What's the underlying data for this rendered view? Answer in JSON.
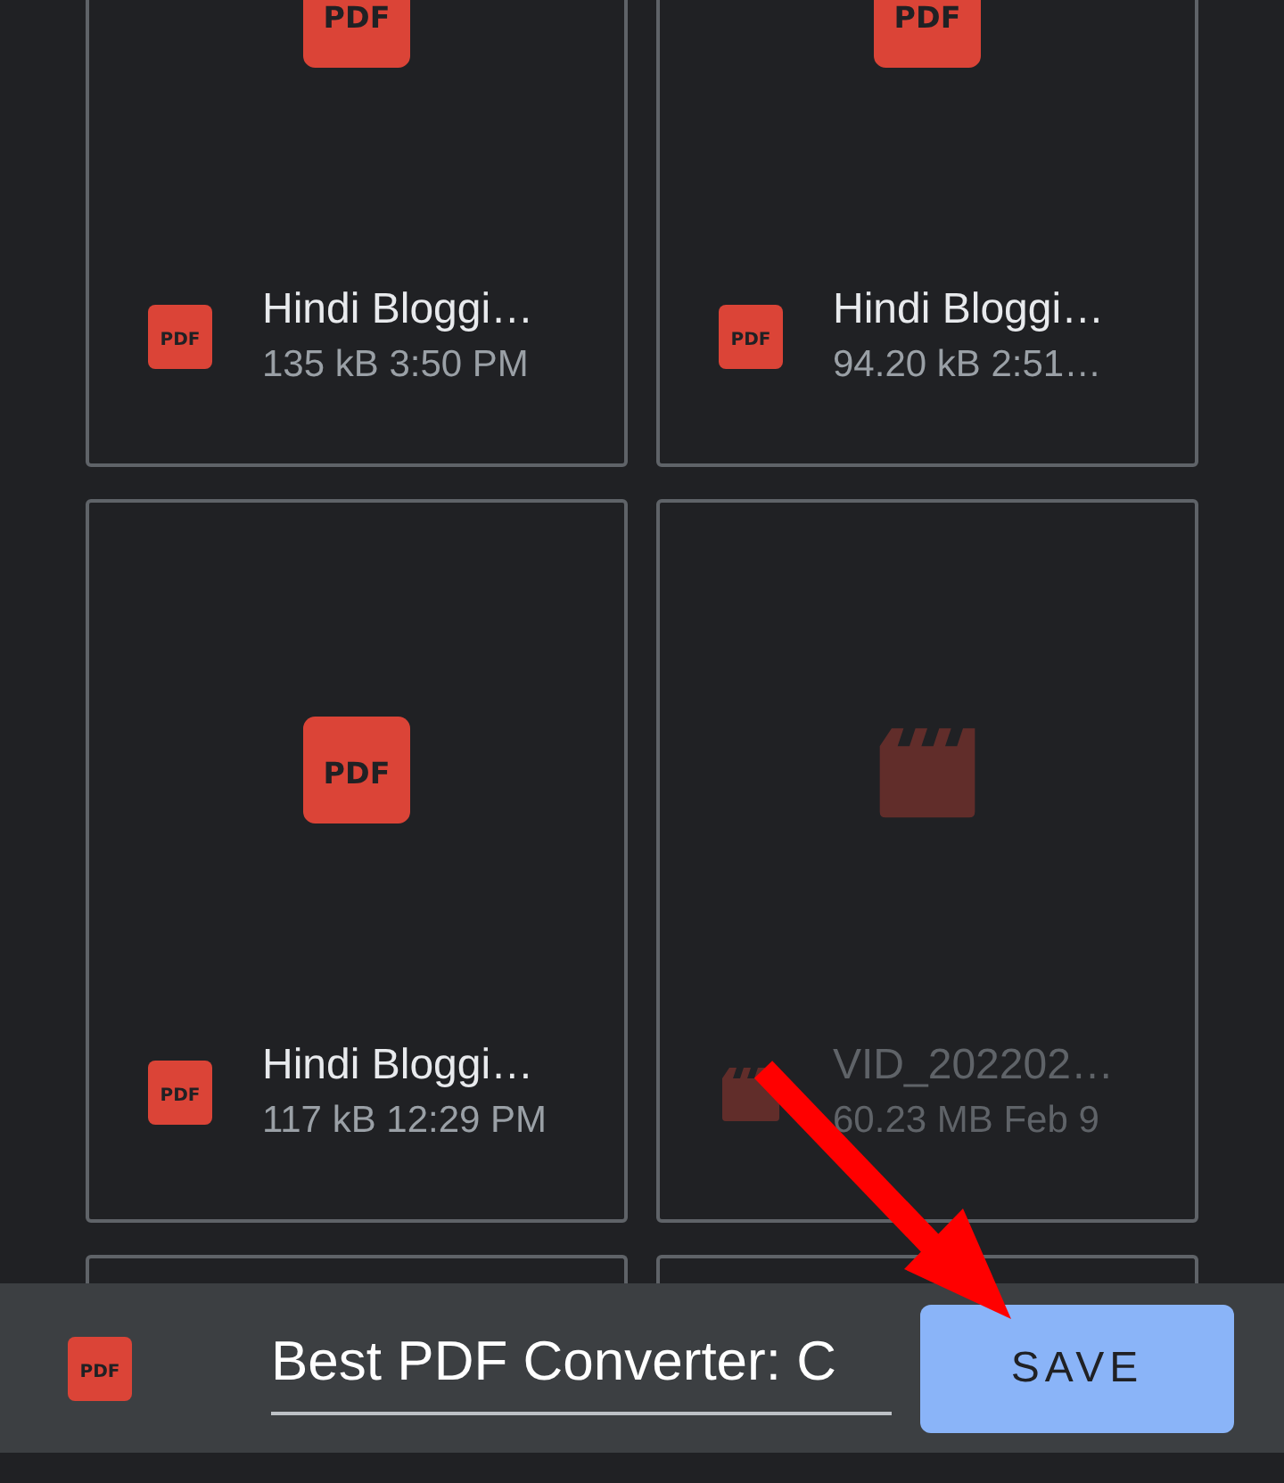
{
  "files": [
    {
      "kind": "pdf",
      "preview_label": "PDF",
      "icon_label": "PDF",
      "name": "Hindi Bloggi…",
      "meta": "135 kB 3:50 PM",
      "disabled": false
    },
    {
      "kind": "pdf",
      "preview_label": "PDF",
      "icon_label": "PDF",
      "name": "Hindi Bloggi…",
      "meta": "94.20 kB 2:51…",
      "disabled": false
    },
    {
      "kind": "pdf",
      "preview_label": "PDF",
      "icon_label": "PDF",
      "name": "Hindi Bloggi…",
      "meta": "117 kB 12:29 PM",
      "disabled": false
    },
    {
      "kind": "video",
      "name": "VID_202202…",
      "meta": "60.23 MB Feb 9",
      "disabled": true
    },
    {
      "kind": "stub"
    },
    {
      "kind": "stub"
    }
  ],
  "save_bar": {
    "kind": "pdf",
    "icon_label": "PDF",
    "filename": "Best PDF Converter: C",
    "button": "SAVE"
  }
}
